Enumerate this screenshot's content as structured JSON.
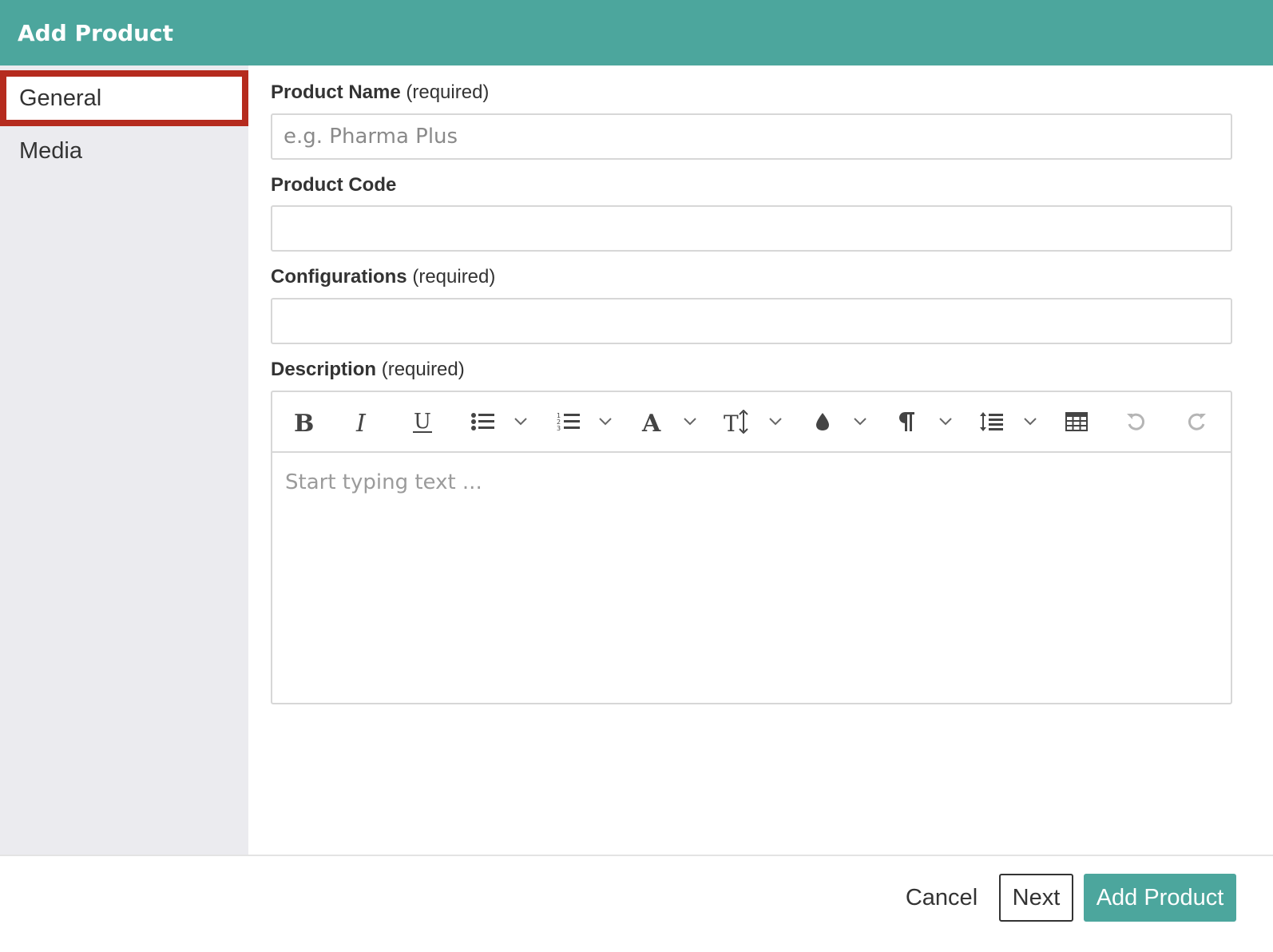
{
  "dialog": {
    "title": "Add Product"
  },
  "sidebar": {
    "items": [
      {
        "label": "General",
        "active": true
      },
      {
        "label": "Media",
        "active": false
      }
    ]
  },
  "form": {
    "product_name": {
      "label": "Product Name",
      "suffix": "(required)",
      "placeholder": "e.g. Pharma Plus",
      "value": ""
    },
    "product_code": {
      "label": "Product Code",
      "value": ""
    },
    "configurations": {
      "label": "Configurations",
      "suffix": "(required)",
      "value": ""
    },
    "description": {
      "label": "Description",
      "suffix": "(required)",
      "placeholder": "Start typing text ..."
    }
  },
  "toolbar": {
    "icons": [
      "bold-icon",
      "italic-icon",
      "underline-icon",
      "bullet-list-icon",
      "numbered-list-icon",
      "font-icon",
      "font-size-icon",
      "text-color-icon",
      "paragraph-icon",
      "line-height-icon",
      "table-icon",
      "undo-icon",
      "redo-icon"
    ]
  },
  "footer": {
    "cancel_label": "Cancel",
    "next_label": "Next",
    "add_label": "Add Product"
  },
  "colors": {
    "accent": "#4ca69d",
    "active_border": "#b52b1e",
    "sidebar_bg": "#ebebef"
  }
}
